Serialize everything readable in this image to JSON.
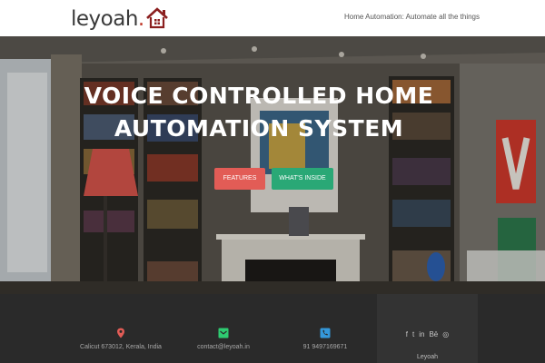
{
  "header": {
    "logo_text": "leyoah",
    "logo_dot": ".",
    "tagline": "Home Automation: Automate all the things"
  },
  "hero": {
    "title_line1": "VOICE CONTROLLED HOME",
    "title_line2": "AUTOMATION SYSTEM",
    "buttons": {
      "features": "FEATURES",
      "whats_inside": "WHAT'S INSIDE"
    }
  },
  "footer": {
    "contacts": [
      {
        "icon": "map-marker-icon",
        "text": "Calicut 673012, Kerala, India",
        "color": "#e25c56"
      },
      {
        "icon": "envelope-icon",
        "text": "contact@leyoah.in",
        "color": "#2ecc71"
      },
      {
        "icon": "phone-icon",
        "text": "91 9497169671",
        "color": "#3498db"
      }
    ],
    "social": {
      "facebook": "f",
      "twitter": "t",
      "linkedin": "in",
      "behance": "Bē",
      "dribbble": "◎"
    },
    "brand": "Leyoah"
  },
  "colors": {
    "brand_red": "#c0392b",
    "features_button": "#e25c56",
    "whats_inside_button": "#2aa876",
    "footer_bg": "#2a2a2a",
    "footer_side_bg": "#333333"
  }
}
